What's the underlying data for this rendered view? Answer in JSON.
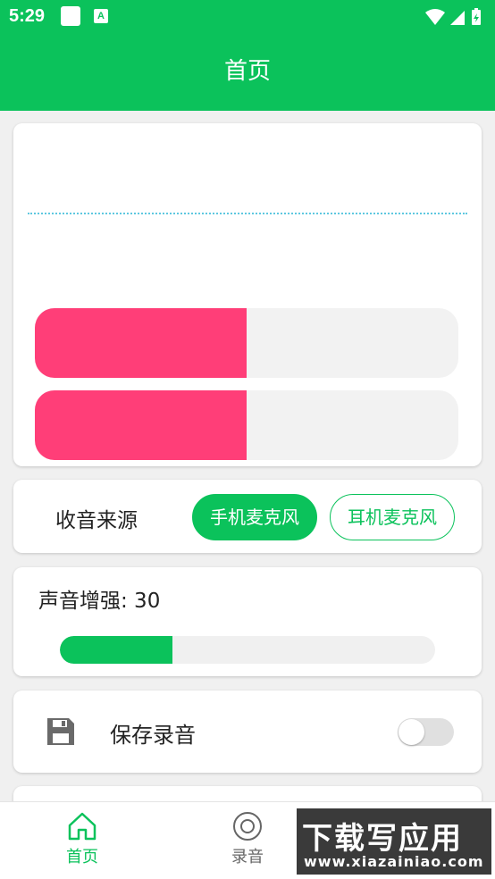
{
  "status_bar": {
    "time": "5:29"
  },
  "app_bar": {
    "title": "首页"
  },
  "meters": {
    "level_1": 0.5,
    "level_2": 0.5,
    "fill_color": "#ff3e78",
    "wave_color": "#5ec8e0"
  },
  "audio_source": {
    "label": "收音来源",
    "options": [
      "手机麦克风",
      "耳机麦克风"
    ],
    "selected": "手机麦克风"
  },
  "boost": {
    "label": "声音增强: 30",
    "value": 30,
    "fill_fraction": 0.3
  },
  "save_recording": {
    "label": "保存录音",
    "icon": "save-icon",
    "enabled": false
  },
  "bottom_nav": {
    "items": [
      {
        "label": "首页",
        "icon": "home-icon",
        "active": true
      },
      {
        "label": "录音",
        "icon": "record-icon",
        "active": false
      }
    ]
  },
  "watermark": {
    "title": "下载写应用",
    "url": "www.xiazainiao.com"
  },
  "colors": {
    "accent": "#0bc25b",
    "meter": "#ff3e78",
    "background": "#f0f0f0"
  }
}
